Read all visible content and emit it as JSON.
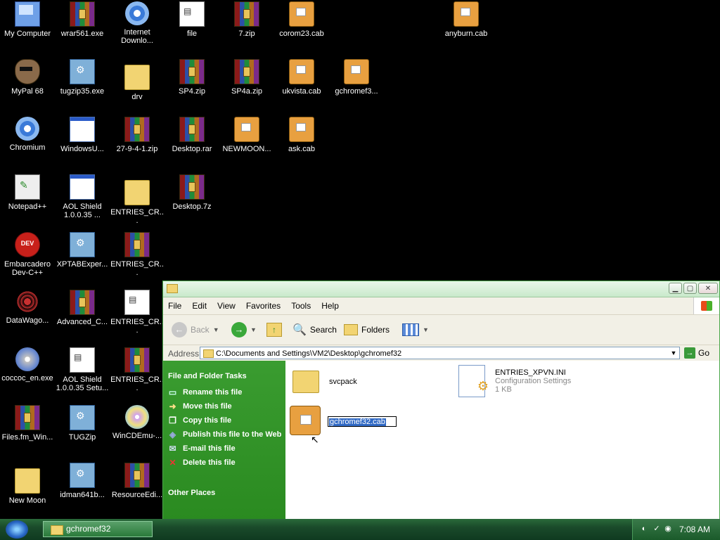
{
  "desktop": {
    "icons": [
      {
        "label": "My Computer",
        "icon": "my-computer-icon"
      },
      {
        "label": "wrar561.exe",
        "icon": "winrar-icon"
      },
      {
        "label": "Internet Downlo...",
        "icon": "internet-download-manager-icon"
      },
      {
        "label": "file",
        "icon": "text-file-icon"
      },
      {
        "label": "7.zip",
        "icon": "winrar-archive-icon"
      },
      {
        "label": "corom23.cab",
        "icon": "cab-file-icon"
      },
      {
        "label": "anyburn.cab",
        "icon": "cab-file-icon"
      },
      {
        "label": "MyPal 68",
        "icon": "mypal-browser-icon"
      },
      {
        "label": "tugzip35.exe",
        "icon": "installer-icon"
      },
      {
        "label": "drv",
        "icon": "folder-icon"
      },
      {
        "label": "SP4.zip",
        "icon": "winrar-archive-icon"
      },
      {
        "label": "SP4a.zip",
        "icon": "winrar-archive-icon"
      },
      {
        "label": "ukvista.cab",
        "icon": "cab-file-icon"
      },
      {
        "label": "gchromef3...",
        "icon": "cab-file-icon"
      },
      {
        "label": "Chromium",
        "icon": "chromium-icon"
      },
      {
        "label": "WindowsU...",
        "icon": "application-window-icon"
      },
      {
        "label": "27-9-4-1.zip",
        "icon": "winrar-archive-icon"
      },
      {
        "label": "Desktop.rar",
        "icon": "winrar-archive-icon"
      },
      {
        "label": "NEWMOON...",
        "icon": "cab-file-icon"
      },
      {
        "label": "ask.cab",
        "icon": "cab-file-icon"
      },
      {
        "label": "Notepad++",
        "icon": "notepad-plus-plus-icon"
      },
      {
        "label": "AOL Shield 1.0.0.35 ...",
        "icon": "application-window-icon"
      },
      {
        "label": "ENTRIES_CR...",
        "icon": "folder-icon"
      },
      {
        "label": "Desktop.7z",
        "icon": "winrar-archive-icon"
      },
      {
        "label": "Embarcadero Dev-C++",
        "icon": "dev-cpp-icon"
      },
      {
        "label": "XPTABExper...",
        "icon": "installer-icon"
      },
      {
        "label": "ENTRIES_CR...",
        "icon": "winrar-archive-icon"
      },
      {
        "label": "DataWago...",
        "icon": "datawagon-icon"
      },
      {
        "label": "Advanced_C...",
        "icon": "winrar-archive-icon"
      },
      {
        "label": "ENTRIES_CR...",
        "icon": "text-file-icon"
      },
      {
        "label": "coccoc_en.exe",
        "icon": "disc-installer-icon"
      },
      {
        "label": "AOL Shield 1.0.0.35 Setu...",
        "icon": "text-file-icon"
      },
      {
        "label": "ENTRIES_CR...",
        "icon": "winrar-archive-icon"
      },
      {
        "label": "Files.fm_Win...",
        "icon": "winrar-archive-icon"
      },
      {
        "label": "TUGZip",
        "icon": "installer-icon"
      },
      {
        "label": "WinCDEmu-...",
        "icon": "wincdemu-icon"
      },
      {
        "label": "New Moon",
        "icon": "folder-icon"
      },
      {
        "label": "idman641b...",
        "icon": "installer-icon"
      },
      {
        "label": "ResourceEdi...",
        "icon": "winrar-archive-icon"
      }
    ]
  },
  "window": {
    "title": "",
    "menu": [
      "File",
      "Edit",
      "View",
      "Favorites",
      "Tools",
      "Help"
    ],
    "toolbar": {
      "back": "Back",
      "search": "Search",
      "folders": "Folders"
    },
    "address": {
      "label": "Address",
      "value": "C:\\Documents and Settings\\VM2\\Desktop\\gchromef32",
      "go": "Go"
    },
    "taskpane": {
      "section1": "File and Folder Tasks",
      "tasks": [
        {
          "label": "Rename this file",
          "icon": "rename-icon"
        },
        {
          "label": "Move this file",
          "icon": "move-icon"
        },
        {
          "label": "Copy this file",
          "icon": "copy-icon"
        },
        {
          "label": "Publish this file to the Web",
          "icon": "publish-web-icon"
        },
        {
          "label": "E-mail this file",
          "icon": "email-icon"
        },
        {
          "label": "Delete this file",
          "icon": "delete-icon"
        }
      ],
      "section2": "Other Places"
    },
    "content": {
      "folder": {
        "name": "svcpack"
      },
      "ini": {
        "name": "ENTRIES_XPVN.INI",
        "type": "Configuration Settings",
        "size": "1 KB"
      },
      "cab": {
        "rename_value": "gchromef32.cab"
      }
    }
  },
  "taskbar": {
    "task": "gchromef32",
    "clock": "7:08 AM"
  }
}
